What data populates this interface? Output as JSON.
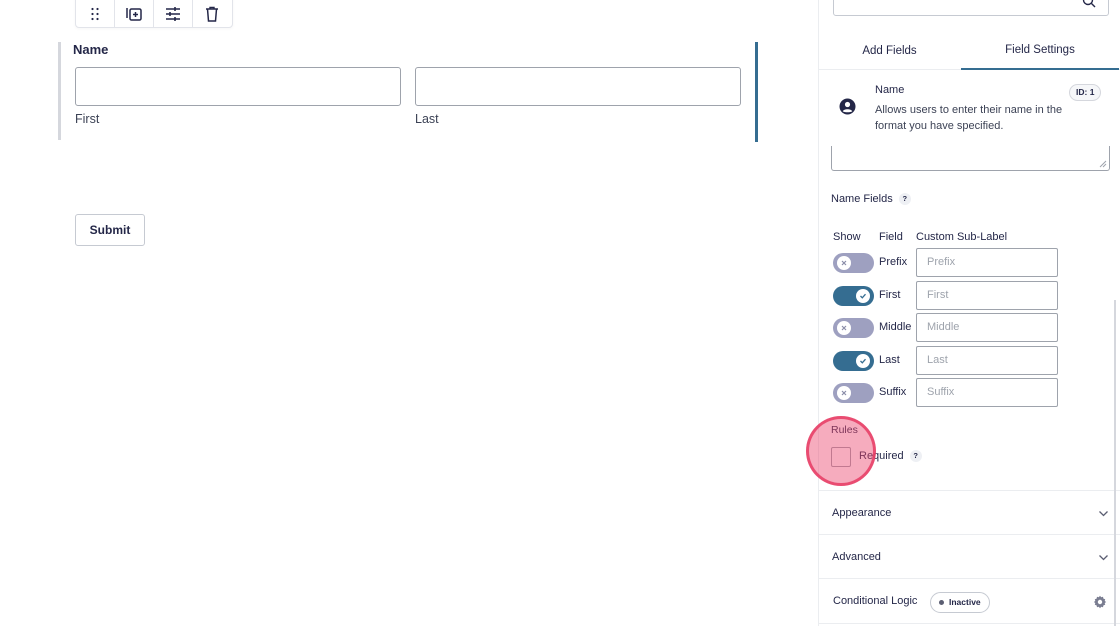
{
  "editor": {
    "toolbar": {
      "icons": [
        "drag-handle-icon",
        "duplicate-icon",
        "settings-sliders-icon",
        "trash-icon"
      ]
    },
    "field": {
      "label": "Name",
      "first_sublabel": "First",
      "last_sublabel": "Last"
    },
    "submit_label": "Submit"
  },
  "sidebar": {
    "tabs": {
      "add_fields": "Add Fields",
      "field_settings": "Field Settings"
    },
    "field_info": {
      "title": "Name",
      "description": "Allows users to enter their name in the format you have specified.",
      "id_badge": "ID: 1"
    },
    "name_fields": {
      "label": "Name Fields",
      "help": "?",
      "headers": {
        "show": "Show",
        "field": "Field",
        "custom_sublabel": "Custom Sub-Label"
      },
      "rows": [
        {
          "name": "Prefix",
          "enabled": false,
          "placeholder": "Prefix"
        },
        {
          "name": "First",
          "enabled": true,
          "placeholder": "First"
        },
        {
          "name": "Middle",
          "enabled": false,
          "placeholder": "Middle"
        },
        {
          "name": "Last",
          "enabled": true,
          "placeholder": "Last"
        },
        {
          "name": "Suffix",
          "enabled": false,
          "placeholder": "Suffix"
        }
      ]
    },
    "rules": {
      "label": "Rules",
      "required_label": "Required",
      "required_checked": false,
      "help": "?"
    },
    "accordions": {
      "appearance": "Appearance",
      "advanced": "Advanced"
    },
    "conditional_logic": {
      "title": "Conditional Logic",
      "status": "Inactive"
    }
  },
  "colors": {
    "accent": "#356d91",
    "toggle_off": "#9ea0c0",
    "click_indicator": "#ec486e"
  }
}
